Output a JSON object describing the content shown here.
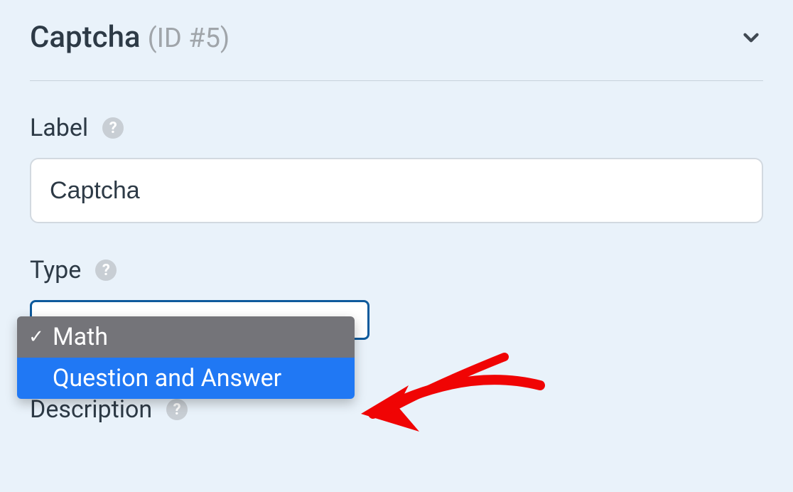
{
  "header": {
    "title": "Captcha",
    "id_label": "(ID #5)"
  },
  "label_field": {
    "label": "Label",
    "value": "Captcha"
  },
  "type_field": {
    "label": "Type",
    "options": [
      {
        "label": "Math",
        "selected": true
      },
      {
        "label": "Question and Answer",
        "selected": false
      }
    ]
  },
  "description_field": {
    "label": "Description"
  }
}
